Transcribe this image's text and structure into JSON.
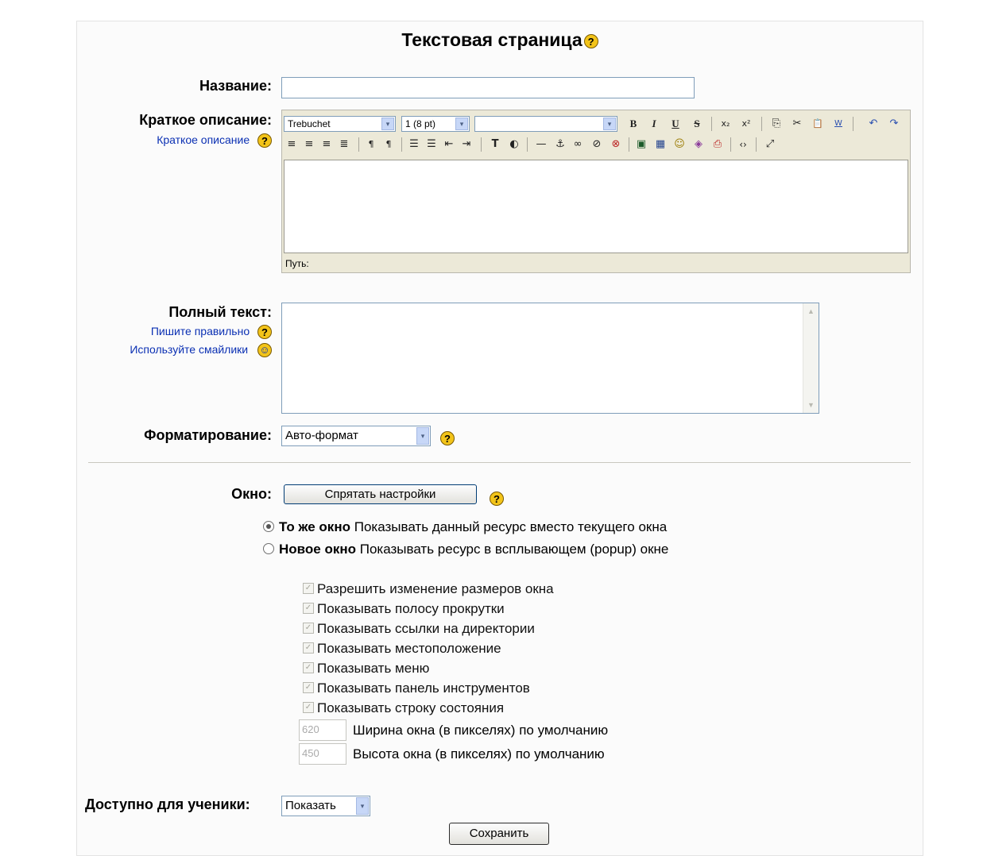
{
  "page": {
    "title": "Текстовая страница"
  },
  "fields": {
    "name_label": "Название:",
    "summary_label": "Краткое описание:",
    "summary_help_link": "Краткое описание",
    "fulltext_label": "Полный текст:",
    "write_correctly_link": "Пишите правильно",
    "use_smileys_link": "Используйте смайлики",
    "format_label": "Форматирование:",
    "format_value": "Авто-формат",
    "window_label": "Окно:",
    "hide_settings_button": "Спрятать настройки",
    "available_label": "Доступно для ученики:",
    "available_value": "Показать",
    "save_button": "Сохранить"
  },
  "editor": {
    "font_value": "Trebuchet",
    "size_value": "1 (8 pt)",
    "style_value": "",
    "path_label": "Путь:",
    "row1_buttons": [
      "B",
      "I",
      "U",
      "S",
      "x₂",
      "x²",
      "⎘",
      "✂",
      "📋",
      "W",
      "↶",
      "↷"
    ],
    "row2_buttons": [
      "≡",
      "≡",
      "≡",
      "≣",
      "¶",
      "¶",
      "☰",
      "☰",
      "⇤",
      "⇥",
      "T",
      "◐",
      "—",
      "⚓",
      "∞",
      "⊘",
      "⊗",
      "▣",
      "▦",
      "☺",
      "◈",
      "⎙",
      "‹›",
      "⤢"
    ]
  },
  "window_options": [
    {
      "title": "То же окно",
      "desc": "Показывать данный ресурс вместо текущего окна",
      "selected": true
    },
    {
      "title": "Новое окно",
      "desc": "Показывать ресурс в всплывающем (popup) окне",
      "selected": false
    }
  ],
  "popup_options": [
    "Разрешить изменение размеров окна",
    "Показывать полосу прокрутки",
    "Показывать ссылки на директории",
    "Показывать местоположение",
    "Показывать меню",
    "Показывать панель инструментов",
    "Показывать строку состояния"
  ],
  "dimensions": {
    "width_value": "620",
    "width_label": "Ширина окна (в пикселях) по умолчанию",
    "height_value": "450",
    "height_label": "Высота окна (в пикселях) по умолчанию"
  },
  "icons": {
    "help": "?",
    "smiley": "☺",
    "checkmark": "✓",
    "dropdown_arrow": "▾"
  }
}
